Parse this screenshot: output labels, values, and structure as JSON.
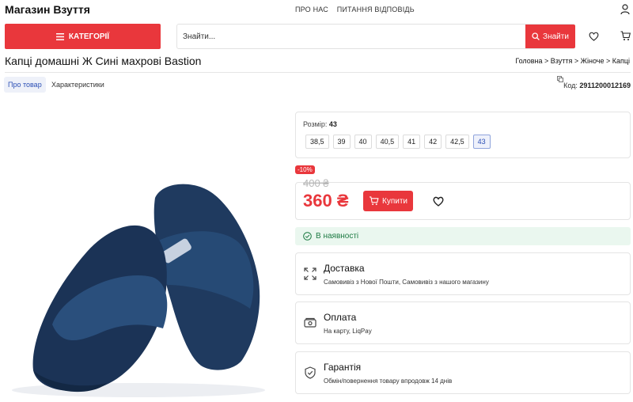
{
  "header": {
    "shop_name": "Магазин Взуття",
    "links": [
      "ПРО НАС",
      "ПИТАННЯ ВІДПОВІДЬ"
    ],
    "categories_label": "КАТЕГОРІЇ",
    "search_placeholder": "Знайти...",
    "search_button": "Знайти"
  },
  "product": {
    "title": "Капці домашні Ж Сині махрові Bastion",
    "breadcrumb": "Головна > Взуття > Жіноче > Капці",
    "tabs": [
      "Про товар",
      "Характеристики"
    ],
    "code_label": "Код:",
    "code_value": "2911200012169",
    "size_label": "Розмір:",
    "selected_size": "43",
    "sizes": [
      "38,5",
      "39",
      "40",
      "40,5",
      "41",
      "42",
      "42,5",
      "43"
    ],
    "discount": "-10%",
    "old_price": "400 ₴",
    "new_price": "360 ₴",
    "buy_label": "Купити",
    "stock": "В наявності"
  },
  "info": {
    "delivery": {
      "title": "Доставка",
      "text": "Самовивіз з Нової Пошти, Самовивіз з нашого магазину"
    },
    "payment": {
      "title": "Оплата",
      "text": "На карту, LiqPay"
    },
    "guarantee": {
      "title": "Гарантія",
      "text": "Обмін/повернення товару впродовж 14 днів"
    }
  },
  "colors": {
    "accent": "#e9373c",
    "stock_bg": "#eaf7ef",
    "stock_text": "#1d7a43",
    "slipper": "#1f3a5f"
  },
  "icons": [
    "menu-icon",
    "search-icon",
    "user-icon",
    "heart-icon",
    "cart-icon",
    "copy-icon",
    "check-circle-icon",
    "expand-icon",
    "wallet-icon",
    "shield-icon"
  ]
}
